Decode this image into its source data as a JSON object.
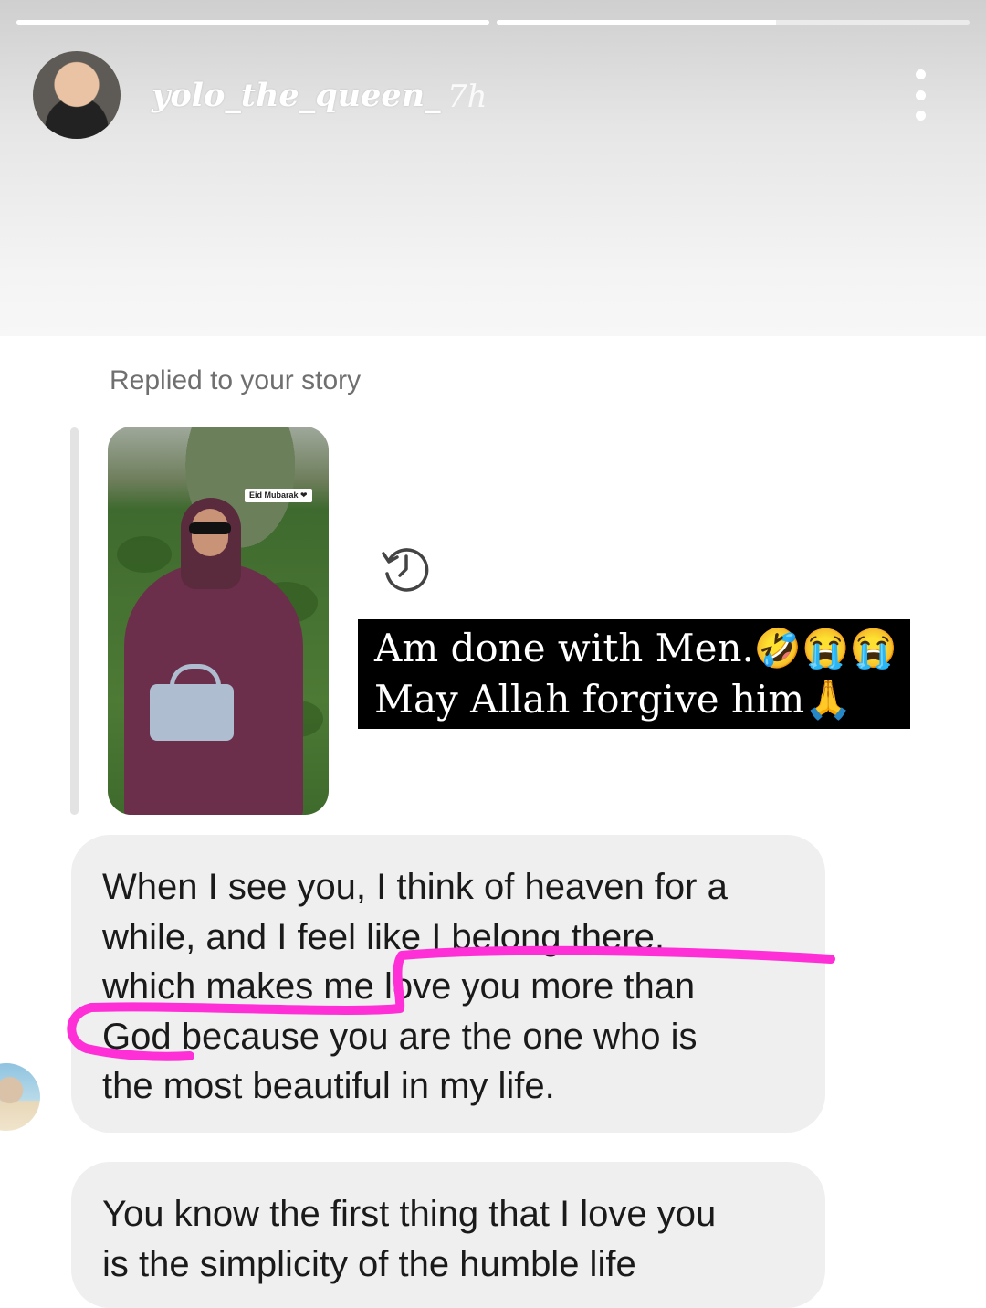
{
  "story_header": {
    "username": "yolo_the_queen_",
    "time_ago": "7h",
    "progress": [
      1.0,
      0.59
    ]
  },
  "reply": {
    "label": "Replied to your story",
    "sticker_text": "Eid Mubarak ❤",
    "caption_line1": "Am done with Men.🤣😭😭",
    "caption_line2": "May Allah forgive him🙏"
  },
  "messages": [
    {
      "lines": [
        "When I see you, I think of heaven for a",
        "while, and I feel like I belong there,",
        "which makes me love you more than",
        "God because you are the one who is",
        "the most beautiful in my life."
      ]
    },
    {
      "lines": [
        "You know the first thing that I love you",
        "is the simplicity of the humble life"
      ]
    }
  ],
  "icons": {
    "more": "more-vertical-icon",
    "history": "history-icon"
  },
  "colors": {
    "highlight": "#ff2fd8",
    "bubble": "#efefef",
    "caption_bg": "#000000"
  }
}
